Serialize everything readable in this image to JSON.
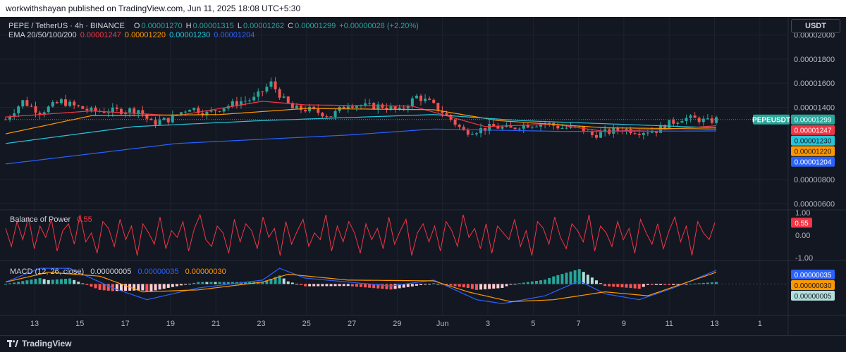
{
  "caption": "workwithshayan published on TradingView.com, Jun 11, 2025 18:08 UTC+5:30",
  "footer": {
    "brand": "TradingView"
  },
  "price_pane": {
    "symbol_line": "PEPE / TetherUS · 4h · BINANCE",
    "ohlc": {
      "o_label": "O",
      "o": "0.00001270",
      "h_label": "H",
      "h": "0.00001315",
      "l_label": "L",
      "l": "0.00001262",
      "c_label": "C",
      "c": "0.00001299",
      "change": "+0.00000028 (+2.20%)"
    },
    "ema_label": "EMA 20/50/100/200",
    "ema_values": [
      "0.00001247",
      "0.00001220",
      "0.00001230",
      "0.00001204"
    ],
    "unit": "USDT",
    "ticker_label": "PEPEUSDT",
    "last_price": "0.00001299"
  },
  "bop_pane": {
    "label": "Balance of Power",
    "value": "0.55"
  },
  "macd_pane": {
    "label": "MACD (12, 26, close)",
    "values": [
      "0.00000005",
      "0.00000035",
      "0.00000030"
    ]
  },
  "colors": {
    "background": "#131722",
    "grid": "#1e222d",
    "up": "#26a69a",
    "down": "#ef5350",
    "ema20": "#f23645",
    "ema50": "#ff9800",
    "ema100": "#26c6da",
    "ema200": "#2962ff",
    "bop_line": "#f23645",
    "macd_line": "#2962ff",
    "signal_line": "#ff9800"
  },
  "chart_data": [
    {
      "type": "candlestick",
      "title": "PEPE / TetherUS · 4h · BINANCE",
      "y_axis_ticks": [
        "0.00002000",
        "0.00001800",
        "0.00001600",
        "0.00001400",
        "0.00000800",
        "0.00000600"
      ],
      "ylim": [
        5.5e-06,
        2.15e-05
      ],
      "x_axis_ticks": [
        "13",
        "15",
        "17",
        "19",
        "21",
        "23",
        "25",
        "27",
        "29",
        "Jun",
        "3",
        "5",
        "7",
        "9",
        "11",
        "13",
        "1"
      ],
      "close_path": [
        [
          0,
          1.3e-05
        ],
        [
          4,
          1.45e-05
        ],
        [
          8,
          1.36e-05
        ],
        [
          13,
          1.45e-05
        ],
        [
          16,
          1.41e-05
        ],
        [
          20,
          1.37e-05
        ],
        [
          25,
          1.37e-05
        ],
        [
          31,
          1.38e-05
        ],
        [
          34,
          1.27e-05
        ],
        [
          38,
          1.3e-05
        ],
        [
          43,
          1.4e-05
        ],
        [
          47,
          1.35e-05
        ],
        [
          50,
          1.39e-05
        ],
        [
          55,
          1.45e-05
        ],
        [
          58,
          1.47e-05
        ],
        [
          62,
          1.6e-05
        ],
        [
          65,
          1.46e-05
        ],
        [
          67,
          1.39e-05
        ],
        [
          71,
          1.38e-05
        ],
        [
          76,
          1.33e-05
        ],
        [
          80,
          1.43e-05
        ],
        [
          84,
          1.41e-05
        ],
        [
          88,
          1.41e-05
        ],
        [
          92,
          1.37e-05
        ],
        [
          96,
          1.49e-05
        ],
        [
          99,
          1.44e-05
        ],
        [
          102,
          1.36e-05
        ],
        [
          104,
          1.3e-05
        ],
        [
          107,
          1.2e-05
        ],
        [
          110,
          1.21e-05
        ],
        [
          114,
          1.24e-05
        ],
        [
          118,
          1.22e-05
        ],
        [
          120,
          1.25e-05
        ],
        [
          123,
          1.26e-05
        ],
        [
          126,
          1.27e-05
        ],
        [
          130,
          1.23e-05
        ],
        [
          134,
          1.23e-05
        ],
        [
          137,
          1.17e-05
        ],
        [
          140,
          1.19e-05
        ],
        [
          144,
          1.22e-05
        ],
        [
          148,
          1.2e-05
        ],
        [
          152,
          1.21e-05
        ],
        [
          154,
          1.25e-05
        ],
        [
          158,
          1.31e-05
        ],
        [
          162,
          1.3e-05
        ],
        [
          164,
          1.28e-05
        ],
        [
          166,
          1.3e-05
        ]
      ],
      "series": [
        {
          "name": "EMA 20",
          "last": 1.247e-05,
          "path": [
            [
              0,
              1.32e-05
            ],
            [
              20,
              1.37e-05
            ],
            [
              40,
              1.33e-05
            ],
            [
              60,
              1.45e-05
            ],
            [
              70,
              1.42e-05
            ],
            [
              95,
              1.41e-05
            ],
            [
              104,
              1.32e-05
            ],
            [
              112,
              1.24e-05
            ],
            [
              128,
              1.26e-05
            ],
            [
              140,
              1.2e-05
            ],
            [
              155,
              1.22e-05
            ],
            [
              166,
              1.247e-05
            ]
          ]
        },
        {
          "name": "EMA 50",
          "last": 1.22e-05,
          "path": [
            [
              0,
              1.18e-05
            ],
            [
              20,
              1.33e-05
            ],
            [
              50,
              1.34e-05
            ],
            [
              70,
              1.39e-05
            ],
            [
              100,
              1.38e-05
            ],
            [
              115,
              1.29e-05
            ],
            [
              140,
              1.23e-05
            ],
            [
              166,
              1.22e-05
            ]
          ]
        },
        {
          "name": "EMA 100",
          "last": 1.23e-05,
          "path": [
            [
              0,
              1.1e-05
            ],
            [
              30,
              1.24e-05
            ],
            [
              60,
              1.29e-05
            ],
            [
              100,
              1.34e-05
            ],
            [
              120,
              1.29e-05
            ],
            [
              166,
              1.23e-05
            ]
          ]
        },
        {
          "name": "EMA 200",
          "last": 1.204e-05,
          "path": [
            [
              0,
              9.3e-06
            ],
            [
              40,
              1.1e-05
            ],
            [
              80,
              1.17e-05
            ],
            [
              100,
              1.22e-05
            ],
            [
              130,
              1.2e-05
            ],
            [
              166,
              1.204e-05
            ]
          ]
        }
      ]
    },
    {
      "type": "line",
      "title": "Balance of Power",
      "y_axis_ticks": [
        "1.00",
        "0.00",
        "-1.00"
      ],
      "ylim": [
        -1.12,
        1.12
      ],
      "series": [
        {
          "name": "Balance of Power",
          "last": 0.55,
          "values": [
            0.3,
            -0.5,
            0.6,
            -0.2,
            0.8,
            -0.6,
            0.4,
            -0.1,
            0.7,
            -0.7,
            0.2,
            0.5,
            -0.4,
            0.9,
            -0.3,
            0.1,
            -0.8,
            0.6,
            0.3,
            -0.5,
            0.7,
            -0.2,
            0.4,
            -0.9,
            0.5,
            0.1,
            -0.4,
            0.8,
            -0.6,
            0.2,
            -0.1,
            0.6,
            -0.7,
            0.3,
            0.9,
            -0.2,
            -0.5,
            0.4,
            0.1,
            -0.8,
            0.7,
            -0.3,
            0.5,
            0.2,
            -0.6,
            0.8,
            -0.1,
            0.3,
            -0.9,
            0.6,
            -0.4,
            0.2,
            0.7,
            -0.5,
            0.1,
            -0.2,
            0.9,
            -0.7,
            0.4,
            -0.3,
            0.6,
            0.1,
            -0.8,
            0.5,
            -0.2,
            0.3,
            -0.6,
            0.8,
            -0.4,
            0.2,
            0.7,
            -0.9,
            0.1,
            0.5,
            -0.3,
            0.4,
            -0.7,
            0.6,
            0.2,
            -0.5,
            0.9,
            -0.1,
            0.3,
            -0.6,
            0.5,
            -0.8,
            0.4,
            0.1,
            -0.2,
            0.7,
            -0.5,
            0.2,
            -0.9,
            0.6,
            0.3,
            -0.4,
            0.8,
            -0.1,
            -0.6,
            0.5,
            0.2,
            -0.3,
            0.9,
            -0.7,
            0.4,
            0.1,
            -0.5,
            0.6,
            -0.2,
            0.3,
            -0.8,
            0.7,
            0.1,
            -0.4,
            0.5,
            -0.6,
            0.2,
            0.8,
            -0.3,
            0.4,
            -0.9,
            0.6,
            0.1,
            -0.2,
            0.55
          ]
        }
      ]
    },
    {
      "type": "bar",
      "title": "MACD (12, 26, close)",
      "ylim": [
        -8e-07,
        6e-07
      ],
      "series": [
        {
          "name": "MACD",
          "last": 3.5e-07,
          "path": [
            [
              0,
              5e-08
            ],
            [
              8,
              4e-07
            ],
            [
              15,
              4e-07
            ],
            [
              25,
              -1e-07
            ],
            [
              33,
              -4e-07
            ],
            [
              45,
              -1e-07
            ],
            [
              60,
              1e-07
            ],
            [
              64,
              4e-07
            ],
            [
              70,
              1.5e-07
            ],
            [
              80,
              5e-08
            ],
            [
              90,
              -5e-08
            ],
            [
              100,
              1e-07
            ],
            [
              110,
              -4e-07
            ],
            [
              116,
              -5e-07
            ],
            [
              126,
              -3e-07
            ],
            [
              134,
              8e-08
            ],
            [
              140,
              -2.5e-07
            ],
            [
              148,
              -4e-07
            ],
            [
              156,
              -1e-07
            ],
            [
              166,
              3.5e-07
            ]
          ]
        },
        {
          "name": "Signal",
          "last": 3e-07,
          "path": [
            [
              0,
              5e-08
            ],
            [
              10,
              3e-07
            ],
            [
              22,
              2e-07
            ],
            [
              32,
              -2e-07
            ],
            [
              45,
              -1.5e-07
            ],
            [
              60,
              5e-08
            ],
            [
              66,
              2.5e-07
            ],
            [
              80,
              1e-07
            ],
            [
              100,
              8e-08
            ],
            [
              108,
              -2e-07
            ],
            [
              118,
              -4.5e-07
            ],
            [
              128,
              -4e-07
            ],
            [
              140,
              -2e-07
            ],
            [
              150,
              -3e-07
            ],
            [
              166,
              3e-07
            ]
          ]
        },
        {
          "name": "Histogram",
          "last": 5e-08
        }
      ]
    }
  ]
}
